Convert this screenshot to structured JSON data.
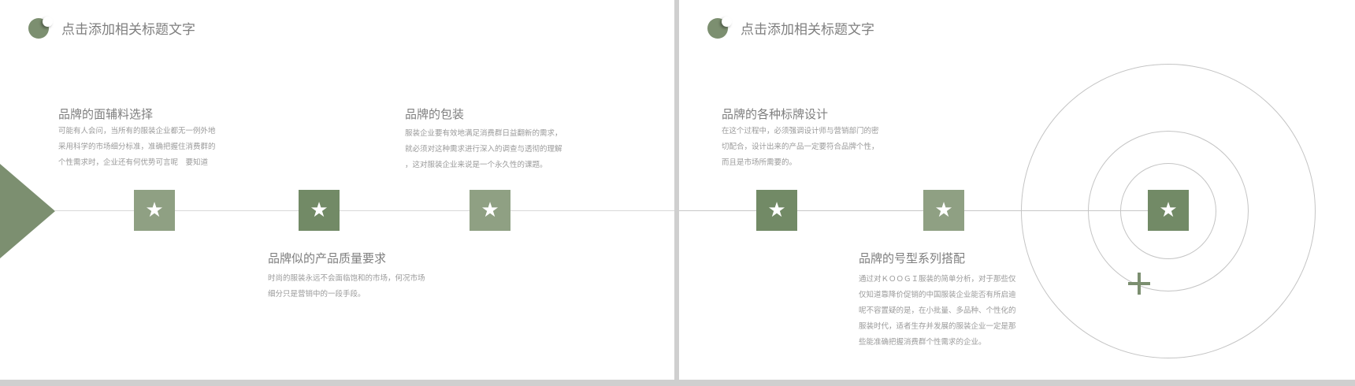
{
  "slide_left": {
    "title": "点击添加相关标题文字",
    "items": [
      {
        "title": "品牌的面辅料选择",
        "lines": [
          "可能有人会问，当所有的服装企业都无一例外地",
          "采用科学的市场细分标准，准确把握住消费群的",
          "个性需求时，企业还有何优势可言呢　要知道"
        ]
      },
      {
        "title": "品牌似的产品质量要求",
        "lines": [
          "时尚的服装永远不会面临饱和的市场，何况市场",
          "细分只是营销中的一段手段。"
        ]
      },
      {
        "title": "品牌的包装",
        "lines": [
          "服装企业要有效地满足消费群日益翻新的需求，",
          "就必须对这种需求进行深入的调查与透彻的理解",
          "，这对服装企业来说是一个永久性的课题。"
        ]
      }
    ],
    "star": "★"
  },
  "slide_right": {
    "title": "点击添加相关标题文字",
    "items": [
      {
        "title": "品牌的各种标牌设计",
        "lines": [
          "在这个过程中，必须强调设计师与营销部门的密",
          "切配合，设计出来的产品一定要符合品牌个性，",
          "而且是市场所需要的。"
        ]
      },
      {
        "title": "品牌的号型系列搭配",
        "lines": [
          "通过对ＫＯＯＧＩ服装的简单分析，对于那些仅",
          "仅知道靠降价促销的中国服装企业能否有所启迪",
          "呢不容置疑的是，在小批量、多品种、个性化的",
          "服装时代，适者生存并发展的服装企业一定是那",
          "些能准确把握消费群个性需求的企业。"
        ]
      }
    ],
    "star": "★"
  },
  "colors": {
    "accent_dark": "#728a66",
    "accent_light": "#8fa083",
    "text_gray": "#7f7f7f"
  }
}
